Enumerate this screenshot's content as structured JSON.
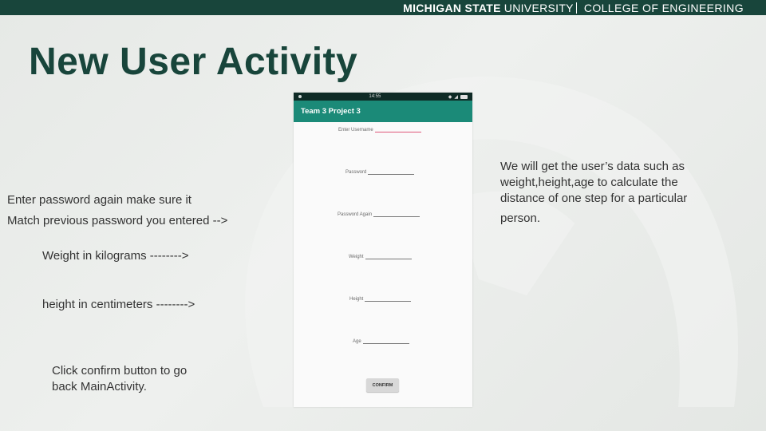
{
  "header": {
    "university_bold": "MICHIGAN STATE",
    "university": "UNIVERSITY",
    "college": "COLLEGE OF ENGINEERING"
  },
  "title": "New User Activity",
  "left_notes": {
    "password_again_line1": "Enter password again make sure it",
    "password_again_line2": "Match previous password you entered -->",
    "weight": "Weight in kilograms  -------->",
    "height": "height in  centimeters   -------->",
    "confirm_line1": "Click confirm button to go",
    "confirm_line2": "back MainActivity."
  },
  "right_note": {
    "line1": "We will get the user’s data such as",
    "line2": "weight,height,age to calculate the",
    "line3": "distance of one step for a particular",
    "line4": "person."
  },
  "phone": {
    "status_time": "14:55",
    "app_title": "Team 3 Project 3",
    "fields": {
      "username": "Enter Username",
      "password": "Password",
      "password_again": "Password Again",
      "weight": "Weight",
      "height": "Height",
      "age": "Age"
    },
    "confirm_label": "CONFIRM"
  },
  "colors": {
    "brand_green": "#18453b",
    "app_bar": "#1b8a78",
    "focused_underline": "#e0567a"
  }
}
